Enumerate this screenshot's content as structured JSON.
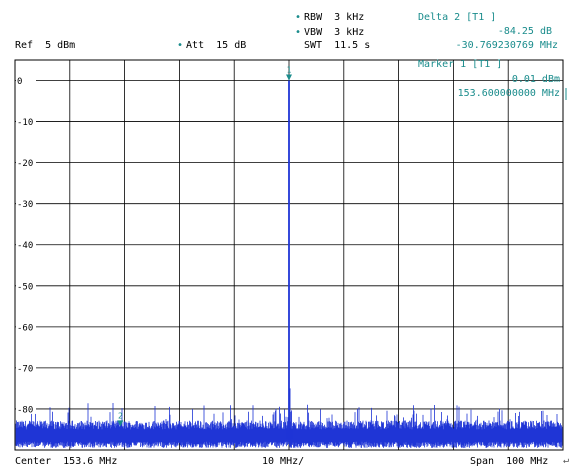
{
  "header": {
    "ref": "Ref  5 dBm",
    "att": "Att  15 dB",
    "rbw": "RBW  3 kHz",
    "vbw": "VBW  3 kHz",
    "swt": "SWT  11.5 s",
    "delta_title": "Delta 2 [T1 ]",
    "delta_level": "-84.25 dB",
    "delta_freq": "-30.769230769 MHz",
    "marker_title": "Marker 1 [T1 ]",
    "marker_level": "0.01 dBm",
    "marker_freq": "153.600000000 MHz"
  },
  "footer": {
    "center": "Center  153.6 MHz",
    "div": "10 MHz/",
    "span": "Span  100 MHz"
  },
  "chart_data": {
    "type": "line",
    "xlabel": "",
    "ylabel": "",
    "x_range_mhz": [
      103.6,
      203.6
    ],
    "ylim": [
      -90,
      5
    ],
    "yticks": [
      0,
      -10,
      -20,
      -30,
      -40,
      -50,
      -60,
      -70,
      -80
    ],
    "ytick_labels": [
      "0",
      "-10",
      "-20",
      "-30",
      "-40",
      "-50",
      "-60",
      "-70",
      "-80"
    ],
    "grid": true,
    "noise_floor_dbm": -86.5,
    "series": [
      {
        "x": [
          153.6,
          153.6
        ],
        "y": [
          0.01,
          -86.5
        ]
      }
    ],
    "markers": [
      {
        "label": "1",
        "x_mhz": 153.6,
        "y_dbm": 0.01
      },
      {
        "label": "2",
        "x_mhz": 122.830769231,
        "y_dbm": -84.24
      }
    ],
    "colors": {
      "trace": "#1f35d6",
      "marker": "#1a8c8c",
      "grid": "#000000"
    }
  }
}
